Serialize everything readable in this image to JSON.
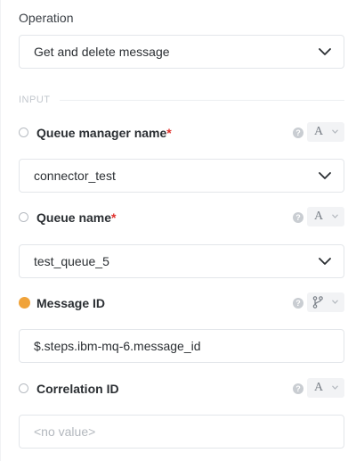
{
  "operation": {
    "label": "Operation",
    "value": "Get and delete message"
  },
  "input_section": {
    "title": "INPUT"
  },
  "fields": {
    "queue_manager": {
      "label": "Queue manager name",
      "required_mark": "*",
      "value": "connector_test",
      "type_glyph": "A"
    },
    "queue_name": {
      "label": "Queue name",
      "required_mark": "*",
      "value": "test_queue_5",
      "type_glyph": "A"
    },
    "message_id": {
      "label": "Message ID",
      "value": "$.steps.ibm-mq-6.message_id"
    },
    "correlation_id": {
      "label": "Correlation ID",
      "placeholder": "<no value>",
      "type_glyph": "A"
    }
  },
  "colors": {
    "accent_orange": "#f0a33a",
    "required_red": "#e0322d",
    "border": "#e3e6ea",
    "muted": "#c2c7cd"
  },
  "icons": {
    "help": "question-circle-icon",
    "chevron": "chevron-down-icon",
    "connector_type": "branch-icon"
  }
}
